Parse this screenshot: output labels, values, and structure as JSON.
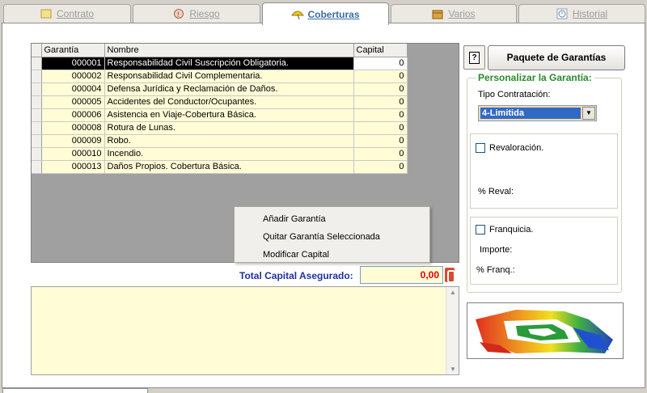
{
  "tabs": [
    {
      "label": "Contrato",
      "icon": "contract-icon"
    },
    {
      "label": "Riesgo",
      "icon": "risk-icon"
    },
    {
      "label": "Coberturas",
      "icon": "umbrella-icon"
    },
    {
      "label": "Varios",
      "icon": "box-icon"
    },
    {
      "label": "Historial",
      "icon": "clock-icon"
    }
  ],
  "active_tab": "Coberturas",
  "grid": {
    "headers": {
      "code": "Garantía",
      "name": "Nombre",
      "capital": "Capital"
    },
    "rows": [
      {
        "code": "000001",
        "name": "Responsabilidad Civil  Suscripción Obligatoria.",
        "capital": "0"
      },
      {
        "code": "000002",
        "name": "Responsabilidad Civil  Complementaria.",
        "capital": "0"
      },
      {
        "code": "000004",
        "name": "Defensa Jurídica y Reclamación de Daños.",
        "capital": "0"
      },
      {
        "code": "000005",
        "name": "Accidentes del Conductor/Ocupantes.",
        "capital": "0"
      },
      {
        "code": "000006",
        "name": "Asistencia en Viaje-Cobertura Básica.",
        "capital": "0"
      },
      {
        "code": "000008",
        "name": "Rotura de Lunas.",
        "capital": "0"
      },
      {
        "code": "000009",
        "name": "Robo.",
        "capital": "0"
      },
      {
        "code": "000010",
        "name": "Incendio.",
        "capital": "0"
      },
      {
        "code": "000013",
        "name": "Daños Propios. Cobertura Básica.",
        "capital": "0"
      }
    ],
    "selected_row": 0
  },
  "context_menu": {
    "items": [
      "Añadir Garantía",
      "Quitar Garantía Seleccionada",
      "Modificar Capital"
    ]
  },
  "total": {
    "label": "Total Capital Asegurado:",
    "value": "0,00"
  },
  "right": {
    "help_label": "?",
    "package_button": "Paquete de Garantías",
    "group_title": "Personalizar la Garantía:",
    "tipo_label": "Tipo Contratación:",
    "tipo_value": "4-Limitida",
    "revaloracion_label": "Revaloración.",
    "reval_label": "% Reval:",
    "franquicia_label": "Franquicia.",
    "importe_label": "Importe:",
    "franq_label": "% Franq.:"
  },
  "colors": {
    "row_bg": "#fffcd6",
    "select_bg": "#fbd8b0",
    "total_value": "#e00000",
    "total_label": "#2030a0",
    "group_title": "#2a8a2a"
  }
}
